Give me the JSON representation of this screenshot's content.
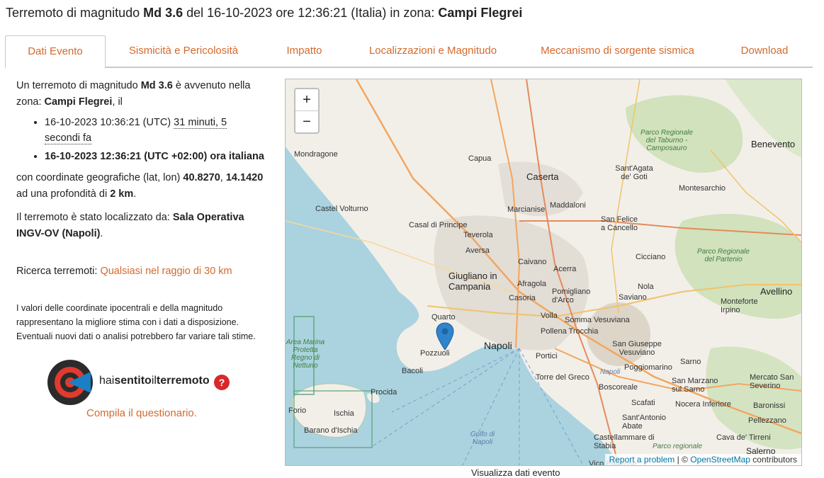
{
  "header": {
    "t1": "Terremoto di magnitudo ",
    "mag": "Md 3.6",
    "t2": " del 16-10-2023 ore 12:36:21 (Italia) in zona: ",
    "zone": "Campi Flegrei"
  },
  "tabs": [
    "Dati Evento",
    "Sismicità e Pericolosità",
    "Impatto",
    "Localizzazioni e Magnitudo",
    "Meccanismo di sorgente sismica",
    "Download"
  ],
  "event": {
    "intro1": "Un terremoto di magnitudo ",
    "mag": "Md 3.6",
    "intro2": " è avvenuto nella zona: ",
    "zone": "Campi Flegrei",
    "intro3": ", il",
    "utc_time": "16-10-2023 10:36:21 (UTC) ",
    "ago": "31 minuti, 5 secondi fa",
    "local_time": "16-10-2023 12:36:21 (UTC +02:00) ora italiana",
    "coord_prefix": "con coordinate geografiche (lat, lon) ",
    "lat": "40.8270",
    "lon": "14.1420",
    "depth_prefix": " ad una profondità di ",
    "depth": "2 km",
    "located_prefix": "Il terremoto è stato localizzato da: ",
    "located_by": "Sala Operativa INGV-OV (Napoli)",
    "search_prefix": "Ricerca terremoti: ",
    "search_link": "Qualsiasi nel raggio di 30 km",
    "disclaimer": "I valori delle coordinate ipocentrali e della magnitudo rappresentano la migliore stima con i dati a disposizione. Eventuali nuovi dati o analisi potrebbero far variare tali stime."
  },
  "hai": {
    "pre": "hai",
    "mid": "sentito",
    "il": "il",
    "post": "terremoto",
    "q": "?",
    "link": "Compila il questionario."
  },
  "map": {
    "zoom_in": "+",
    "zoom_out": "−",
    "attrib_report": "Report a problem",
    "attrib_sep": " | © ",
    "attrib_osm": "OpenStreetMap",
    "attrib_contrib": " contributors",
    "labels": [
      "Mondragone",
      "Capua",
      "Caserta",
      "Benevento",
      "Castel Volturno",
      "Marcianise",
      "Maddaloni",
      "Sant'Agata de' Goti",
      "Montesarchio",
      "Casal di Principe",
      "Teverola",
      "San Felice a Cancello",
      "Aversa",
      "Cicciano",
      "Giugliano in Campania",
      "Caivano",
      "Acerra",
      "Afragola",
      "Nola",
      "Casoria",
      "Pomigliano d'Arco",
      "Saviano",
      "Avellino",
      "Quarto",
      "Volla",
      "Napoli",
      "Somma Vesuviana",
      "Pozzuoli",
      "Pollena Trocchia",
      "Monteforte Irpino",
      "Bacoli",
      "Portici",
      "San Giuseppe Vesuviano",
      "Torre del Greco",
      "Sarno",
      "Procida",
      "Poggiomarino",
      "Boscoreale",
      "San Marzano sul Sarno",
      "Forio",
      "Ischia",
      "Scafati",
      "Nocera Inferiore",
      "Baronissi",
      "Barano d'Ischia",
      "Sant'Antonio Abate",
      "Castellammare di Stabia",
      "Cava de' Tirreni",
      "Salerno",
      "Pellezzano",
      "Mercato San Severino",
      "Vico Equense",
      "Golfo di Napoli",
      "Parco Regionale del Taburno - Camposauro",
      "Parco Regionale del Partenio",
      "Area Marina Protetta Regno di Nettuno",
      "Parco regionale",
      "Napoli"
    ],
    "below": "Visualizza dati evento"
  }
}
